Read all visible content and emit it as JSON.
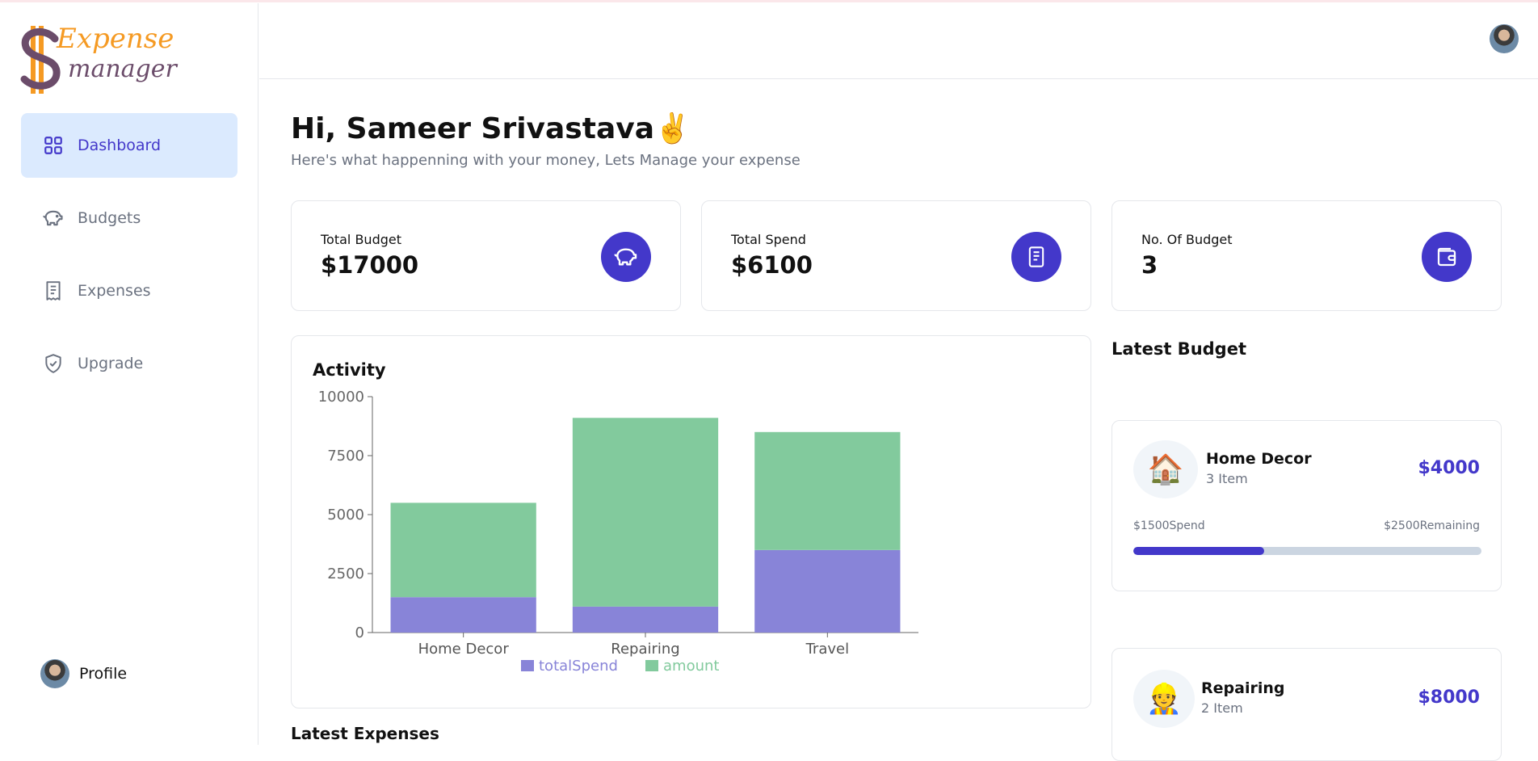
{
  "brand": {
    "line1": "Expense",
    "line2": "manager"
  },
  "sidebar": {
    "items": [
      {
        "label": "Dashboard",
        "icon": "grid-icon",
        "active": true
      },
      {
        "label": "Budgets",
        "icon": "piggy-bank-icon",
        "active": false
      },
      {
        "label": "Expenses",
        "icon": "receipt-icon",
        "active": false
      },
      {
        "label": "Upgrade",
        "icon": "shield-check-icon",
        "active": false
      }
    ],
    "profile_label": "Profile"
  },
  "main": {
    "greeting": "Hi, Sameer Srivastava✌️",
    "subtitle": "Here's what happenning with your money, Lets Manage your expense",
    "cards": [
      {
        "label": "Total Budget",
        "value": "$17000",
        "icon": "piggy-bank-icon"
      },
      {
        "label": "Total Spend",
        "value": "$6100",
        "icon": "receipt-icon"
      },
      {
        "label": "No. Of Budget",
        "value": "3",
        "icon": "wallet-icon"
      }
    ],
    "activity_title": "Activity",
    "latest_expenses_title": "Latest Expenses"
  },
  "chart_data": {
    "type": "bar",
    "stacked": true,
    "title": "Activity",
    "categories": [
      "Home Decor",
      "Repairing",
      "Travel"
    ],
    "series": [
      {
        "name": "totalSpend",
        "values": [
          1500,
          1100,
          3500
        ],
        "color": "#8884d8"
      },
      {
        "name": "amount",
        "values": [
          4000,
          8000,
          5000
        ],
        "color": "#82ca9d"
      }
    ],
    "yticks": [
      "0",
      "2500",
      "5000",
      "7500",
      "10000"
    ],
    "ylim": [
      0,
      10000
    ],
    "legend": "bottom"
  },
  "latest_budget": {
    "title": "Latest Budget",
    "items": [
      {
        "emoji": "🏠",
        "name": "Home Decor",
        "items": "3 Item",
        "amount": "$4000",
        "spend": "$1500Spend",
        "remaining": "$2500Remaining",
        "progress": 0.375
      },
      {
        "emoji": "👷",
        "name": "Repairing",
        "items": "2 Item",
        "amount": "$8000"
      }
    ]
  },
  "colors": {
    "accent": "#4338ca",
    "active_bg": "#dbeafe",
    "logo_orange": "#f59a23",
    "logo_purple": "#6b4c6a"
  }
}
